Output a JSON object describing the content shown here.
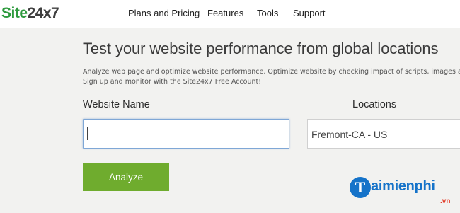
{
  "header": {
    "logo_green": "Site",
    "logo_dark": "24x7",
    "nav": [
      {
        "label": "Plans and Pricing"
      },
      {
        "label": "Features"
      },
      {
        "label": "Tools"
      },
      {
        "label": "Support"
      }
    ]
  },
  "main": {
    "title": "Test your website performance from global locations",
    "description_line1": "Analyze web page and optimize website performance. Optimize website by checking impact of scripts, images and",
    "description_line2": "Sign up and monitor with the Site24x7 Free Account!",
    "website_label": "Website Name",
    "website_value": "",
    "locations_label": "Locations",
    "location_selected": "Fremont-CA - US",
    "analyze_label": "Analyze"
  },
  "watermark": {
    "letter": "T",
    "text": "aimienphi",
    "sub": ".vn"
  },
  "colors": {
    "brand_green": "#2e9a3e",
    "button_green": "#6fac2e",
    "input_focus": "#7fa7d6",
    "watermark_blue": "#1573c9",
    "watermark_red": "#e23d2a"
  }
}
